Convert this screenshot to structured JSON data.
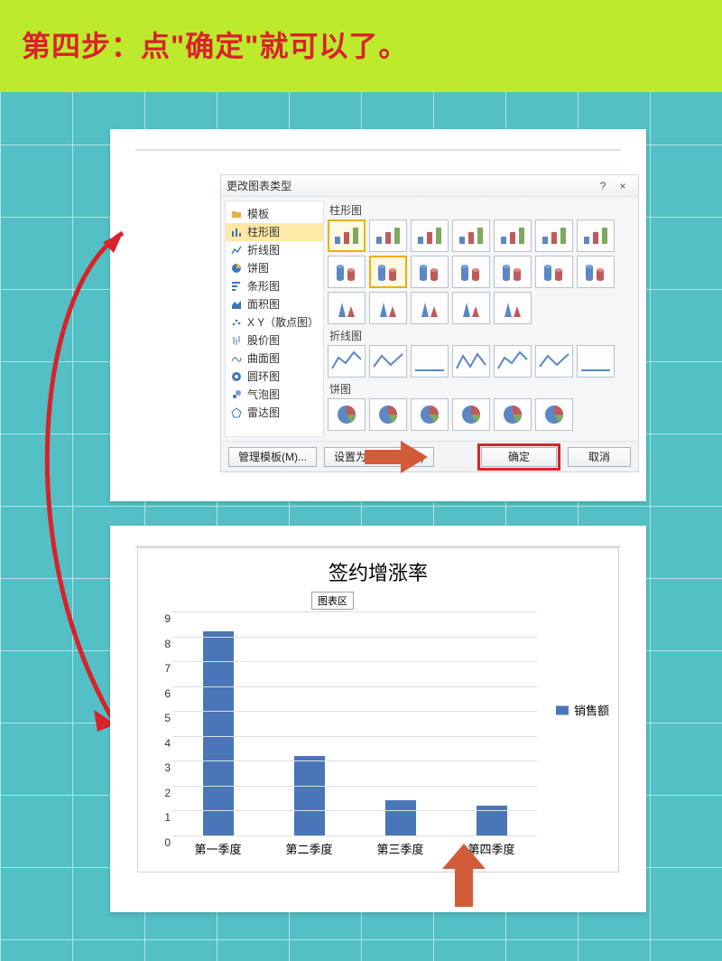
{
  "header": {
    "step_text": "第四步：点\"确定\"就可以了。"
  },
  "dialog": {
    "title": "更改图表类型",
    "help": "?",
    "close": "×",
    "left_items": [
      {
        "label": "模板",
        "icon": "folder"
      },
      {
        "label": "柱形图",
        "icon": "column",
        "selected": true
      },
      {
        "label": "折线图",
        "icon": "line"
      },
      {
        "label": "饼图",
        "icon": "pie"
      },
      {
        "label": "条形图",
        "icon": "bar"
      },
      {
        "label": "面积图",
        "icon": "area"
      },
      {
        "label": "X Y（散点图）",
        "icon": "scatter"
      },
      {
        "label": "股价图",
        "icon": "stock"
      },
      {
        "label": "曲面图",
        "icon": "surface"
      },
      {
        "label": "圆环图",
        "icon": "donut"
      },
      {
        "label": "气泡图",
        "icon": "bubble"
      },
      {
        "label": "雷达图",
        "icon": "radar"
      }
    ],
    "sections": {
      "column": "柱形图",
      "line": "折线图",
      "pie": "饼图"
    },
    "footer": {
      "manage": "管理模板(M)...",
      "setdefault": "设置为默认图表(S)",
      "ok": "确定",
      "cancel": "取消"
    }
  },
  "chart_data": {
    "type": "bar",
    "title": "签约增涨率",
    "chip": "图表区",
    "legend": "销售额",
    "categories": [
      "第一季度",
      "第二季度",
      "第三季度",
      "第四季度"
    ],
    "values": [
      8.2,
      3.2,
      1.4,
      1.2
    ],
    "ymin": 0,
    "ymax": 9,
    "ystep": 1,
    "xlabel": "",
    "ylabel": ""
  },
  "colors": {
    "accent_red": "#d9222a",
    "bar_blue": "#4a76b8",
    "arrow_orange": "#d25c3a"
  }
}
